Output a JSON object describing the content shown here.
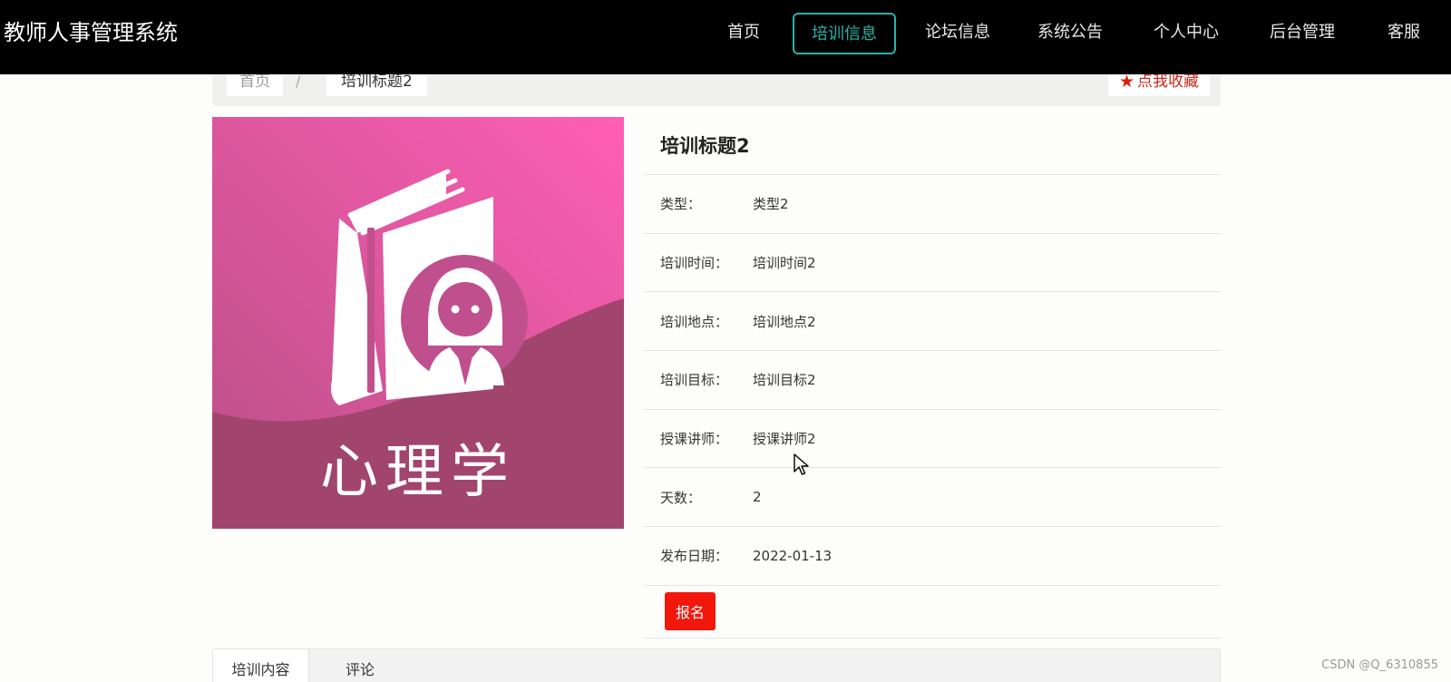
{
  "header": {
    "site_title": "教师人事管理系统",
    "nav": [
      {
        "label": "首页",
        "active": false
      },
      {
        "label": "培训信息",
        "active": true
      },
      {
        "label": "论坛信息",
        "active": false
      },
      {
        "label": "系统公告",
        "active": false
      },
      {
        "label": "个人中心",
        "active": false
      },
      {
        "label": "后台管理",
        "active": false
      },
      {
        "label": "客服",
        "active": false
      }
    ],
    "accent_color": "#2bb2a7"
  },
  "breadcrumb": {
    "home": "首页",
    "separator": "/",
    "current": "培训标题2",
    "favorite_label": "点我收藏",
    "favorite_icon": "star-icon"
  },
  "cover": {
    "caption": "心理学",
    "icon": "book-with-person-icon"
  },
  "detail": {
    "title": "培训标题2",
    "rows": [
      {
        "label": "类型：",
        "value": "类型2"
      },
      {
        "label": "培训时间：",
        "value": "培训时间2"
      },
      {
        "label": "培训地点：",
        "value": "培训地点2"
      },
      {
        "label": "培训目标：",
        "value": "培训目标2"
      },
      {
        "label": "授课讲师：",
        "value": "授课讲师2"
      },
      {
        "label": "天数：",
        "value": "2"
      },
      {
        "label": "发布日期：",
        "value": "2022-01-13"
      }
    ],
    "signup_label": "报名",
    "signup_color": "#f2170b"
  },
  "tabs": [
    {
      "label": "培训内容",
      "active": true
    },
    {
      "label": "评论",
      "active": false
    }
  ],
  "watermark": "CSDN @Q_6310855"
}
